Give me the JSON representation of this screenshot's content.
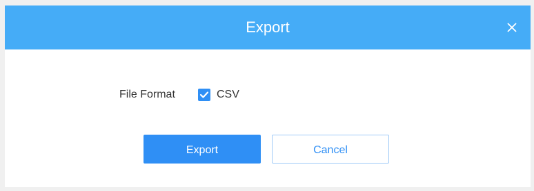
{
  "dialog": {
    "title": "Export",
    "close_icon": "close-icon",
    "header_color": "#45acf7"
  },
  "form": {
    "file_format_label": "File Format",
    "csv_checked": true,
    "csv_label": "CSV",
    "checkbox_color": "#2f8ff5"
  },
  "actions": {
    "export_label": "Export",
    "cancel_label": "Cancel"
  }
}
